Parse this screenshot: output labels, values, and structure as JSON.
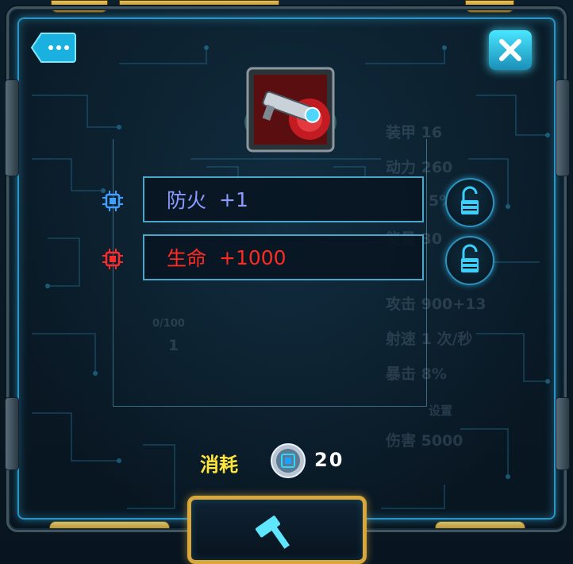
{
  "colors": {
    "accent_cyan": "#3fd3ff",
    "frame_gold": "#d8a83c",
    "fire_text": "#8c9cff",
    "life_text": "#ff2a22",
    "cost_label": "#ffe53a",
    "chip_blue": "#3fa0ff",
    "chip_red": "#ff2a2a"
  },
  "header": {
    "chat_icon": "chat-bubble-icon",
    "close_icon": "close-x-icon"
  },
  "item": {
    "icon": "laser-gun-item-icon"
  },
  "attributes": [
    {
      "name": "防火",
      "value": "+1",
      "chip_color": "blue",
      "locked": false
    },
    {
      "name": "生命",
      "value": "+1000",
      "chip_color": "red",
      "locked": false
    }
  ],
  "background_stats": {
    "armor": "装甲 16",
    "power": "动力 260",
    "pct": "5%",
    "energy": "能量 30",
    "attack": "攻击 900+13",
    "fire_rate": "射速 1 次/秒",
    "crit": "暴击 8%",
    "damage": "伤害 5000",
    "progress": "0/100",
    "level": "1",
    "settings": "设置"
  },
  "cost": {
    "label": "消耗",
    "currency_icon": "chip-coin-icon",
    "amount": "20"
  },
  "actions": {
    "forge_icon": "hammer-icon"
  }
}
